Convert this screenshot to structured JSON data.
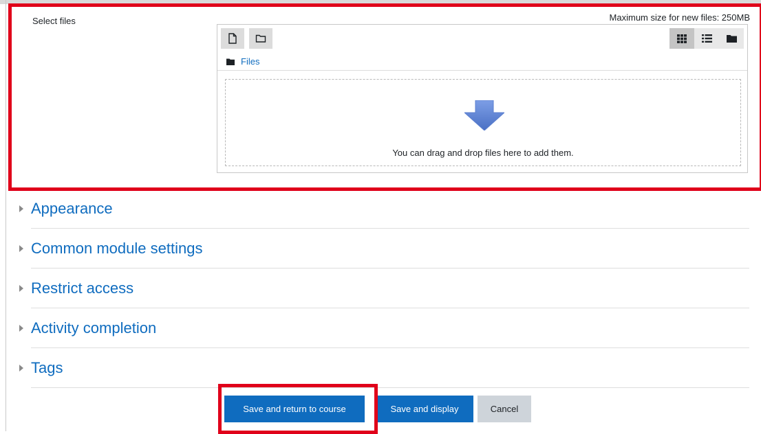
{
  "filemanager": {
    "select_files_label": "Select files",
    "max_size_text": "Maximum size for new files: 250MB",
    "toolbar": {
      "add_file_icon": "file-icon",
      "create_folder_icon": "folder-outline-icon",
      "view_icons": [
        "grid-icon",
        "list-icon",
        "folder-tree-icon"
      ],
      "active_view": "grid"
    },
    "path": {
      "folder_icon": "folder-icon",
      "label": "Files"
    },
    "dropzone": {
      "arrow_icon": "down-arrow-icon",
      "text": "You can drag and drop files here to add them."
    }
  },
  "sections": [
    {
      "title": "Appearance"
    },
    {
      "title": "Common module settings"
    },
    {
      "title": "Restrict access"
    },
    {
      "title": "Activity completion"
    },
    {
      "title": "Tags"
    }
  ],
  "buttons": {
    "save_return": "Save and return to course",
    "save_display": "Save and display",
    "cancel": "Cancel"
  },
  "colors": {
    "highlight": "#e0001a",
    "link": "#0f6cbf",
    "primary_button": "#0f6cbf",
    "secondary_button": "#ced4da"
  }
}
